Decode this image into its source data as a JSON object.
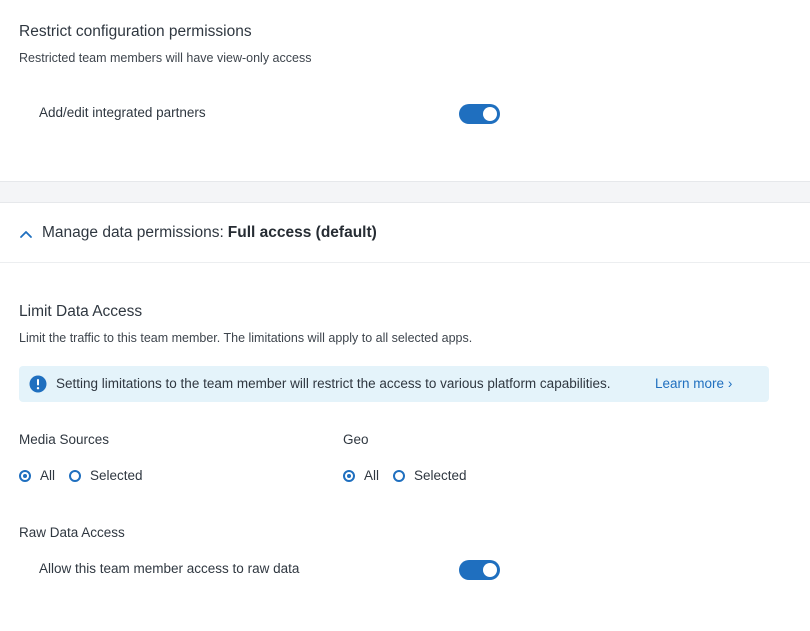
{
  "restrict_config": {
    "title": "Restrict configuration permissions",
    "subtitle": "Restricted team members will have view-only access",
    "partners_label": "Add/edit integrated partners",
    "partners_enabled": true
  },
  "manage_data": {
    "label": "Manage data permissions:",
    "value": "Full access (default)",
    "expanded": true
  },
  "limit_data": {
    "title": "Limit Data Access",
    "subtitle": "Limit the traffic to this team member. The limitations will apply to all selected apps."
  },
  "banner": {
    "text": "Setting limitations to the team member will restrict the access to various platform capabilities.",
    "link": "Learn more",
    "link_chevron": "›"
  },
  "media_sources": {
    "label": "Media Sources",
    "options": [
      "All",
      "Selected"
    ],
    "selected": "All"
  },
  "geo": {
    "label": "Geo",
    "options": [
      "All",
      "Selected"
    ],
    "selected": "All"
  },
  "raw_data": {
    "title": "Raw Data Access",
    "toggle_label": "Allow this team member access to raw data",
    "enabled": true
  },
  "colors": {
    "accent": "#1f6fbf",
    "banner_bg": "#e4f3fa",
    "separator": "#f4f5f7"
  }
}
